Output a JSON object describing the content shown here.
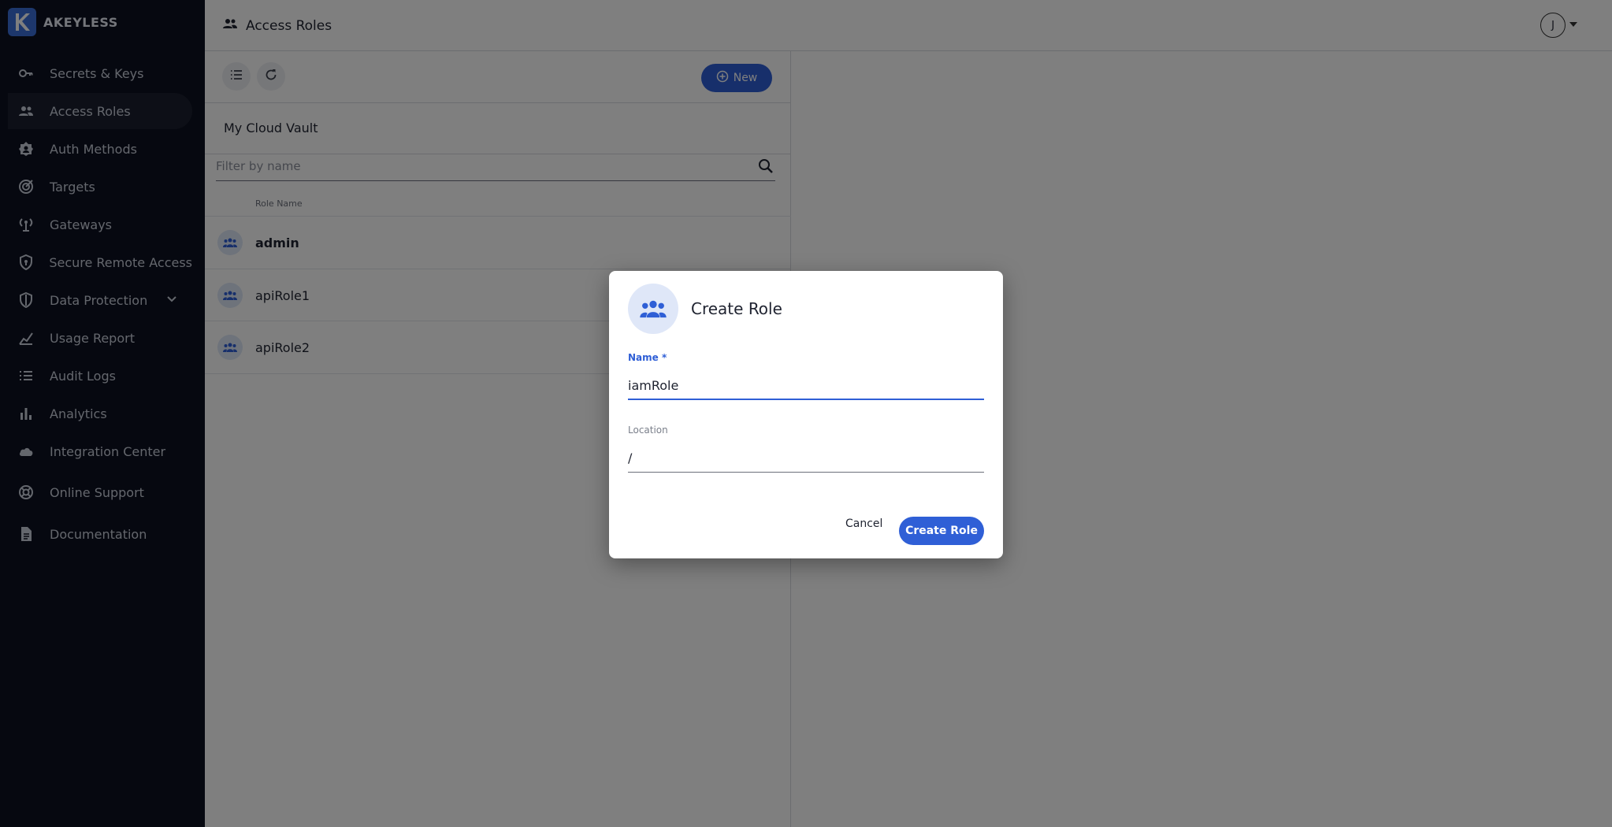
{
  "brand": {
    "name": "AKEYLESS",
    "logo_letter": "K"
  },
  "sidebar": {
    "items": [
      {
        "label": "Secrets & Keys",
        "icon": "key-icon"
      },
      {
        "label": "Access Roles",
        "icon": "people-icon",
        "active": true
      },
      {
        "label": "Auth Methods",
        "icon": "badge-icon"
      },
      {
        "label": "Targets",
        "icon": "target-icon"
      },
      {
        "label": "Gateways",
        "icon": "gateway-icon"
      },
      {
        "label": "Secure Remote Access",
        "icon": "shield-icon"
      },
      {
        "label": "Data Protection",
        "icon": "data-protection-icon",
        "expandable": true
      },
      {
        "label": "Usage Report",
        "icon": "chart-icon"
      },
      {
        "label": "Audit Logs",
        "icon": "list-icon"
      },
      {
        "label": "Analytics",
        "icon": "bar-chart-icon"
      },
      {
        "label": "Integration Center",
        "icon": "cloud-icon"
      },
      {
        "label": "Online Support",
        "icon": "support-icon"
      },
      {
        "label": "Documentation",
        "icon": "document-icon"
      }
    ]
  },
  "header": {
    "title": "Access Roles",
    "avatar_initial": "J"
  },
  "panel": {
    "new_label": "New",
    "breadcrumb": "My Cloud Vault",
    "filter_placeholder": "Filter by name",
    "column_header": "Role Name",
    "rows": [
      {
        "name": "admin",
        "bold": true
      },
      {
        "name": "apiRole1",
        "bold": false
      },
      {
        "name": "apiRole2",
        "bold": false
      }
    ]
  },
  "dialog": {
    "title": "Create Role",
    "name_label": "Name *",
    "name_value": "iamRole",
    "location_label": "Location",
    "location_value": "/",
    "cancel_label": "Cancel",
    "create_label": "Create Role"
  },
  "colors": {
    "accent": "#2f5fd6",
    "sidebar_bg": "#0d1120",
    "overlay": "rgba(0,0,0,0.5)"
  }
}
